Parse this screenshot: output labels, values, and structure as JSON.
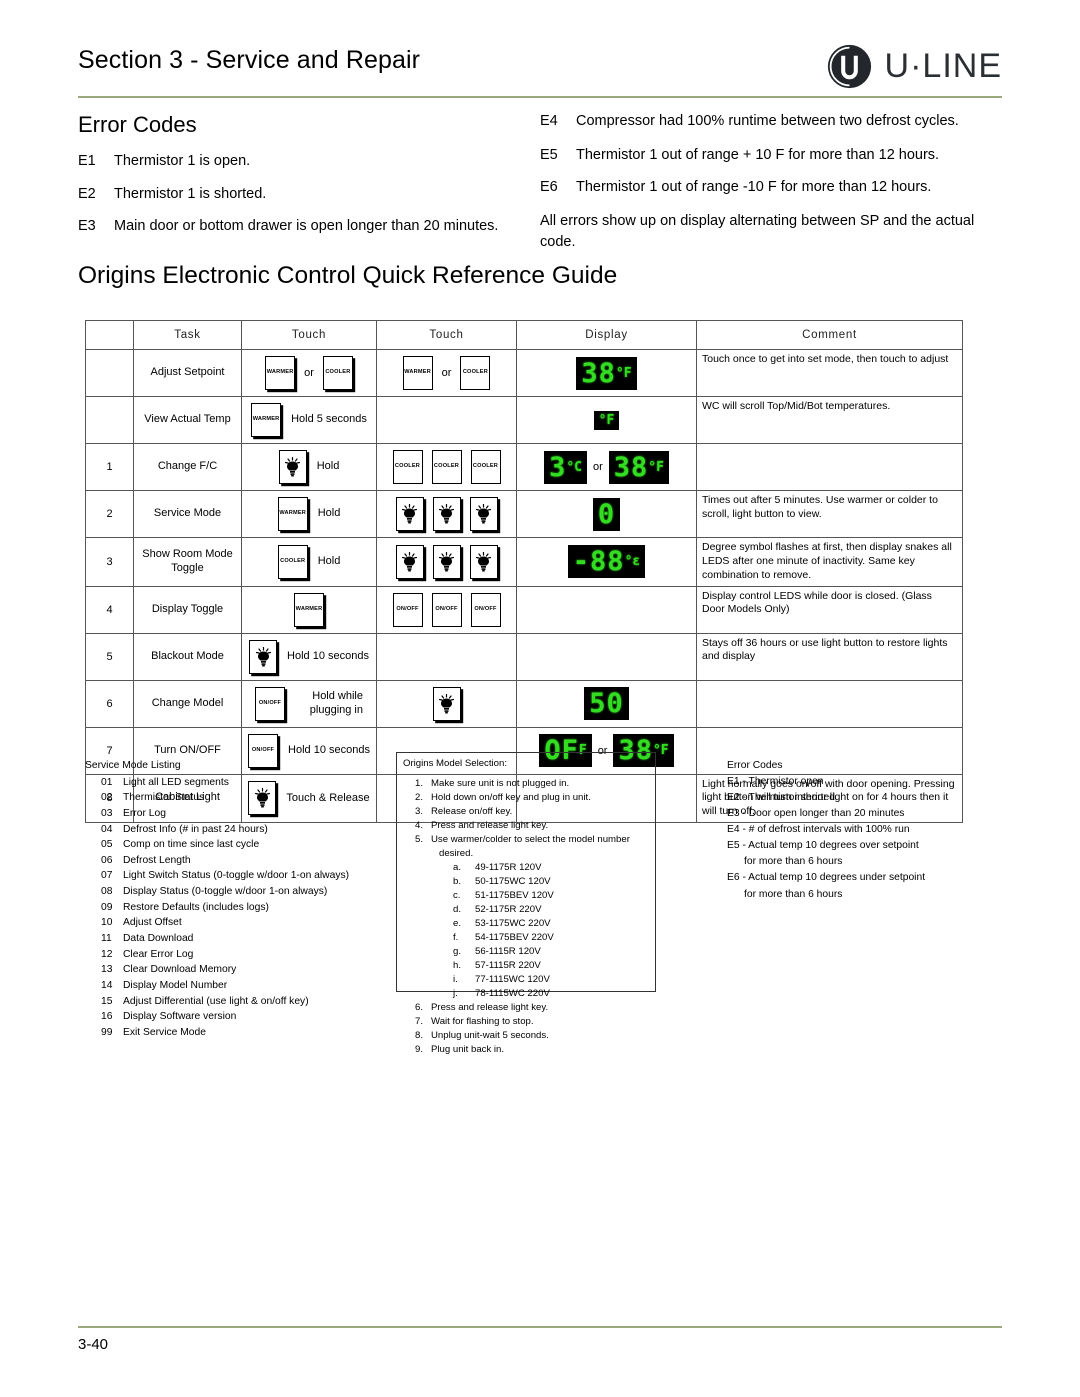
{
  "header": {
    "section_title": "Section 3 - Service and Repair",
    "logo_text": "U·LINE",
    "rule_color": "#9aa87c"
  },
  "error_codes_top": {
    "heading": "Error Codes",
    "left": [
      {
        "code": "E1",
        "text": "Thermistor 1 is open."
      },
      {
        "code": "E2",
        "text": "Thermistor 1 is shorted."
      },
      {
        "code": "E3",
        "text": "Main door or bottom drawer is open longer than 20 minutes."
      }
    ],
    "right": [
      {
        "code": "E4",
        "text": "Compressor had 100% runtime between two defrost cycles.",
        "overlap": "tw"
      },
      {
        "code": "E5",
        "text": "Thermistor 1 out of range + 10 F for more than 12 hours."
      },
      {
        "code": "E6",
        "text": "Thermistor 1 out of range -10 F for more than 12 hours."
      }
    ],
    "note": "All errors show up on display alternating between SP and the actual code."
  },
  "guide_title": "Origins Electronic Control Quick Reference Guide",
  "table": {
    "headers": [
      "",
      "Task",
      "Touch",
      "Touch",
      "Display",
      "Comment"
    ],
    "rows": [
      {
        "num": "",
        "task": "Adjust Setpoint",
        "touch1": {
          "type": "keys-or",
          "keys": [
            "WARMER",
            "COOLER"
          ],
          "or": "or",
          "shadow": true
        },
        "touch2": {
          "type": "keys-or",
          "keys": [
            "WARMER",
            "COOLER"
          ],
          "or": "or",
          "shadow": false
        },
        "display": {
          "type": "led",
          "items": [
            {
              "value": "38",
              "unit": "°F"
            }
          ]
        },
        "comment": "Touch once to get into set mode, then touch to adjust"
      },
      {
        "num": "",
        "task": "View Actual Temp",
        "touch1": {
          "type": "key-hold",
          "key": "WARMER",
          "hold": "Hold 5 seconds",
          "shadow": true
        },
        "touch2": {
          "type": "empty"
        },
        "display": {
          "type": "led",
          "items": [
            {
              "value": "",
              "unit": "°F"
            }
          ]
        },
        "comment": "WC will scroll Top/Mid/Bot temperatures."
      },
      {
        "num": "1",
        "task": "Change F/C",
        "touch1": {
          "type": "lamp-hold",
          "hold": "Hold",
          "shadow": true
        },
        "touch2": {
          "type": "keys3",
          "keys": [
            "COOLER",
            "COOLER",
            "COOLER"
          ]
        },
        "display": {
          "type": "led-or",
          "items": [
            {
              "value": "3",
              "unit": "°C"
            },
            {
              "value": "38",
              "unit": "°F"
            }
          ],
          "or": "or"
        },
        "comment": ""
      },
      {
        "num": "2",
        "task": "Service Mode",
        "touch1": {
          "type": "key-hold",
          "key": "WARMER",
          "hold": "Hold",
          "shadow": true
        },
        "touch2": {
          "type": "lamps3"
        },
        "display": {
          "type": "led",
          "items": [
            {
              "value": "0",
              "unit": ""
            }
          ]
        },
        "comment": "Times out after 5 minutes. Use warmer or colder to scroll, light button to view."
      },
      {
        "num": "3",
        "task": "Show Room Mode Toggle",
        "touch1": {
          "type": "key-hold",
          "key": "COOLER",
          "hold": "Hold",
          "shadow": true
        },
        "touch2": {
          "type": "lamps3"
        },
        "display": {
          "type": "led",
          "items": [
            {
              "value": "-88",
              "unit": "°ε"
            }
          ]
        },
        "comment": "Degree symbol flashes at first, then display snakes all LEDS after one minute of inactivity. Same key combination to remove."
      },
      {
        "num": "4",
        "task": "Display Toggle",
        "touch1": {
          "type": "key-hold",
          "key": "WARMER",
          "hold": "",
          "shadow": true
        },
        "touch2": {
          "type": "keys3",
          "keys": [
            "ON/\nOFF",
            "ON/\nOFF",
            "ON/\nOFF"
          ]
        },
        "display": {
          "type": "empty"
        },
        "comment": "Display control LEDS while door is closed. (Glass Door Models Only)"
      },
      {
        "num": "5",
        "task": "Blackout Mode",
        "touch1": {
          "type": "lamp-hold",
          "hold": "Hold 10 seconds",
          "shadow": true
        },
        "touch2": {
          "type": "empty"
        },
        "display": {
          "type": "empty"
        },
        "comment": "Stays off 36 hours or use light button to restore lights and display"
      },
      {
        "num": "6",
        "task": "Change Model",
        "touch1": {
          "type": "key-hold2",
          "key": "ON/\nOFF",
          "hold": "Hold while plugging in",
          "shadow": true
        },
        "touch2": {
          "type": "lamp1"
        },
        "display": {
          "type": "led",
          "items": [
            {
              "value": "50",
              "unit": ""
            }
          ]
        },
        "comment": ""
      },
      {
        "num": "7",
        "task": "Turn ON/OFF",
        "touch1": {
          "type": "key-hold",
          "key": "ON/\nOFF",
          "hold": "Hold 10 seconds",
          "shadow": true
        },
        "touch2": {
          "type": "empty"
        },
        "display": {
          "type": "led-or",
          "items": [
            {
              "value": "OF",
              "unit": "F"
            },
            {
              "value": "38",
              "unit": "°F"
            }
          ],
          "or": "or"
        },
        "comment": ""
      },
      {
        "num": "8",
        "task": "Cabinet Light",
        "touch1": {
          "type": "lamp-hold",
          "hold": "Touch & Release",
          "shadow": true
        },
        "touch2": {
          "type": "empty"
        },
        "display": {
          "type": "empty"
        },
        "comment": "Light normally goes on/off with door opening. Pressing light button will turn interior light on for 4 hours then it will turn off."
      }
    ]
  },
  "service_mode_listing": {
    "heading": "Service Mode Listing",
    "items": [
      {
        "n": "01",
        "t": "Light all LED segments"
      },
      {
        "n": "02",
        "t": "Thermistor Status"
      },
      {
        "n": "03",
        "t": "Error Log"
      },
      {
        "n": "04",
        "t": "Defrost Info (# in past 24 hours)"
      },
      {
        "n": "05",
        "t": "Comp on time since last cycle"
      },
      {
        "n": "06",
        "t": "Defrost Length"
      },
      {
        "n": "07",
        "t": "Light Switch Status (0-toggle w/door 1-on always)"
      },
      {
        "n": "08",
        "t": "Display Status (0-toggle w/door 1-on always)"
      },
      {
        "n": "09",
        "t": "Restore Defaults (includes logs)"
      },
      {
        "n": "10",
        "t": "Adjust Offset"
      },
      {
        "n": "11",
        "t": "Data Download"
      },
      {
        "n": "12",
        "t": "Clear Error Log"
      },
      {
        "n": "13",
        "t": "Clear Download Memory"
      },
      {
        "n": "14",
        "t": "Display Model Number"
      },
      {
        "n": "15",
        "t": "Adjust Differential (use light & on/off key)"
      },
      {
        "n": "16",
        "t": "Display Software version"
      },
      {
        "n": "99",
        "t": "Exit Service Mode"
      }
    ]
  },
  "model_selection": {
    "heading": "Origins Model Selection:",
    "steps": [
      {
        "n": "1.",
        "t": "Make sure unit is not plugged in."
      },
      {
        "n": "2.",
        "t": "Hold down on/off key and plug in unit."
      },
      {
        "n": "3.",
        "t": "Release on/off key."
      },
      {
        "n": "4.",
        "t": "Press and release light key."
      },
      {
        "n": "5.",
        "t": "Use warmer/colder to select the model number",
        "cont": "desired."
      }
    ],
    "models": [
      {
        "n": "a.",
        "t": "49-1175R 120V"
      },
      {
        "n": "b.",
        "t": "50-1175WC 120V"
      },
      {
        "n": "c.",
        "t": "51-1175BEV 120V"
      },
      {
        "n": "d.",
        "t": "52-1175R 220V"
      },
      {
        "n": "e.",
        "t": "53-1175WC 220V"
      },
      {
        "n": "f.",
        "t": "54-1175BEV 220V"
      },
      {
        "n": "g.",
        "t": "56-1115R 120V"
      },
      {
        "n": "h.",
        "t": "57-1115R 220V"
      },
      {
        "n": "i.",
        "t": "77-1115WC 120V"
      },
      {
        "n": "j.",
        "t": "78-1115WC 220V"
      }
    ],
    "steps_after": [
      {
        "n": "6.",
        "t": "Press and release light key."
      },
      {
        "n": "7.",
        "t": "Wait for flashing to stop."
      },
      {
        "n": "8.",
        "t": "Unplug unit-wait 5 seconds."
      },
      {
        "n": "9.",
        "t": "Plug unit back in."
      }
    ]
  },
  "error_panel": {
    "heading": "Error Codes",
    "lines": [
      {
        "t": "E1 - Thermistor open"
      },
      {
        "t": "E2 - Thermistor shorted"
      },
      {
        "t": "E3 - Door open longer than 20 minutes"
      },
      {
        "t": "E4 - # of defrost intervals with 100% run"
      },
      {
        "t": "E5 - Actual temp 10 degrees over setpoint",
        "cont": "for more than 6 hours"
      },
      {
        "t": "E6 - Actual temp 10 degrees under setpoint",
        "cont": "for more than 6 hours"
      }
    ]
  },
  "footer": {
    "folio": "3-40"
  },
  "colors": {
    "led_green": "#33dd22",
    "led_bg": "#000000",
    "rule": "#9aa87c",
    "logo": "#2b2f33"
  }
}
